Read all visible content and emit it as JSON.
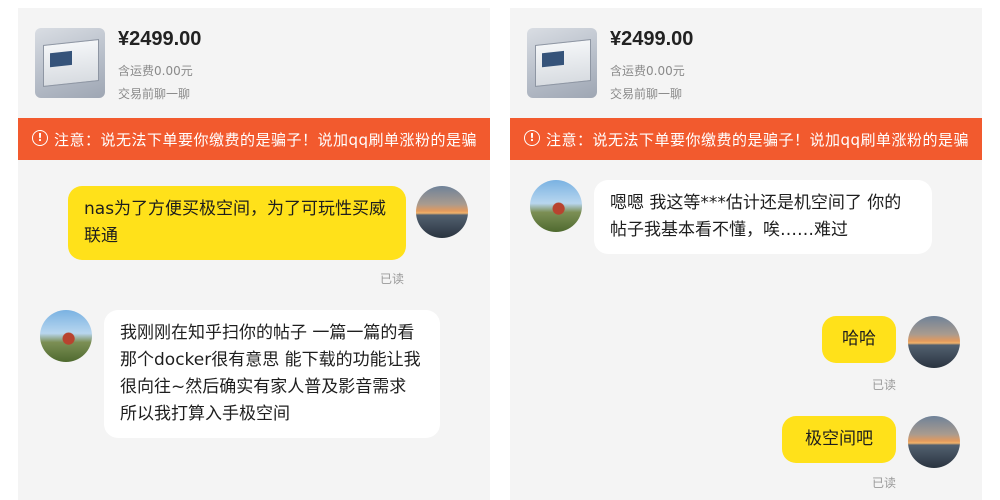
{
  "panels": [
    {
      "product": {
        "price": "¥2499.00",
        "shipping": "含运费0.00元",
        "chat_before": "交易前聊一聊"
      },
      "warning": {
        "icon": "alert-circle-icon",
        "text": "注意：说无法下单要你缴费的是骗子！说加qq刷单涨粉的是骗"
      },
      "messages": [
        {
          "side": "right",
          "bubble": "yellow",
          "avatar": "sunset-avatar",
          "text": "nas为了方便买极空间，为了可玩性买威联通",
          "status": "已读"
        },
        {
          "side": "left",
          "bubble": "white",
          "avatar": "temple-avatar",
          "text": "我刚刚在知乎扫你的帖子 一篇一篇的看 那个docker很有意思 能下载的功能让我很向往~然后确实有家人普及影音需求 所以我打算入手极空间"
        }
      ]
    },
    {
      "product": {
        "price": "¥2499.00",
        "shipping": "含运费0.00元",
        "chat_before": "交易前聊一聊"
      },
      "warning": {
        "icon": "alert-circle-icon",
        "text": "注意：说无法下单要你缴费的是骗子！说加qq刷单涨粉的是骗"
      },
      "messages": [
        {
          "side": "left",
          "bubble": "white",
          "avatar": "temple-avatar",
          "text": "嗯嗯 我这等***估计还是机空间了 你的帖子我基本看不懂，唉……难过"
        },
        {
          "side": "right",
          "bubble": "yellow",
          "avatar": "sunset-avatar",
          "text": "哈哈",
          "status": "已读"
        },
        {
          "side": "right",
          "bubble": "yellow",
          "avatar": "sunset-avatar",
          "text": "极空间吧",
          "status": "已读"
        }
      ]
    }
  ],
  "colors": {
    "warning_bg": "#f25a2e",
    "own_bubble": "#ffe11a",
    "peer_bubble": "#ffffff",
    "background": "#f4f4f4"
  }
}
